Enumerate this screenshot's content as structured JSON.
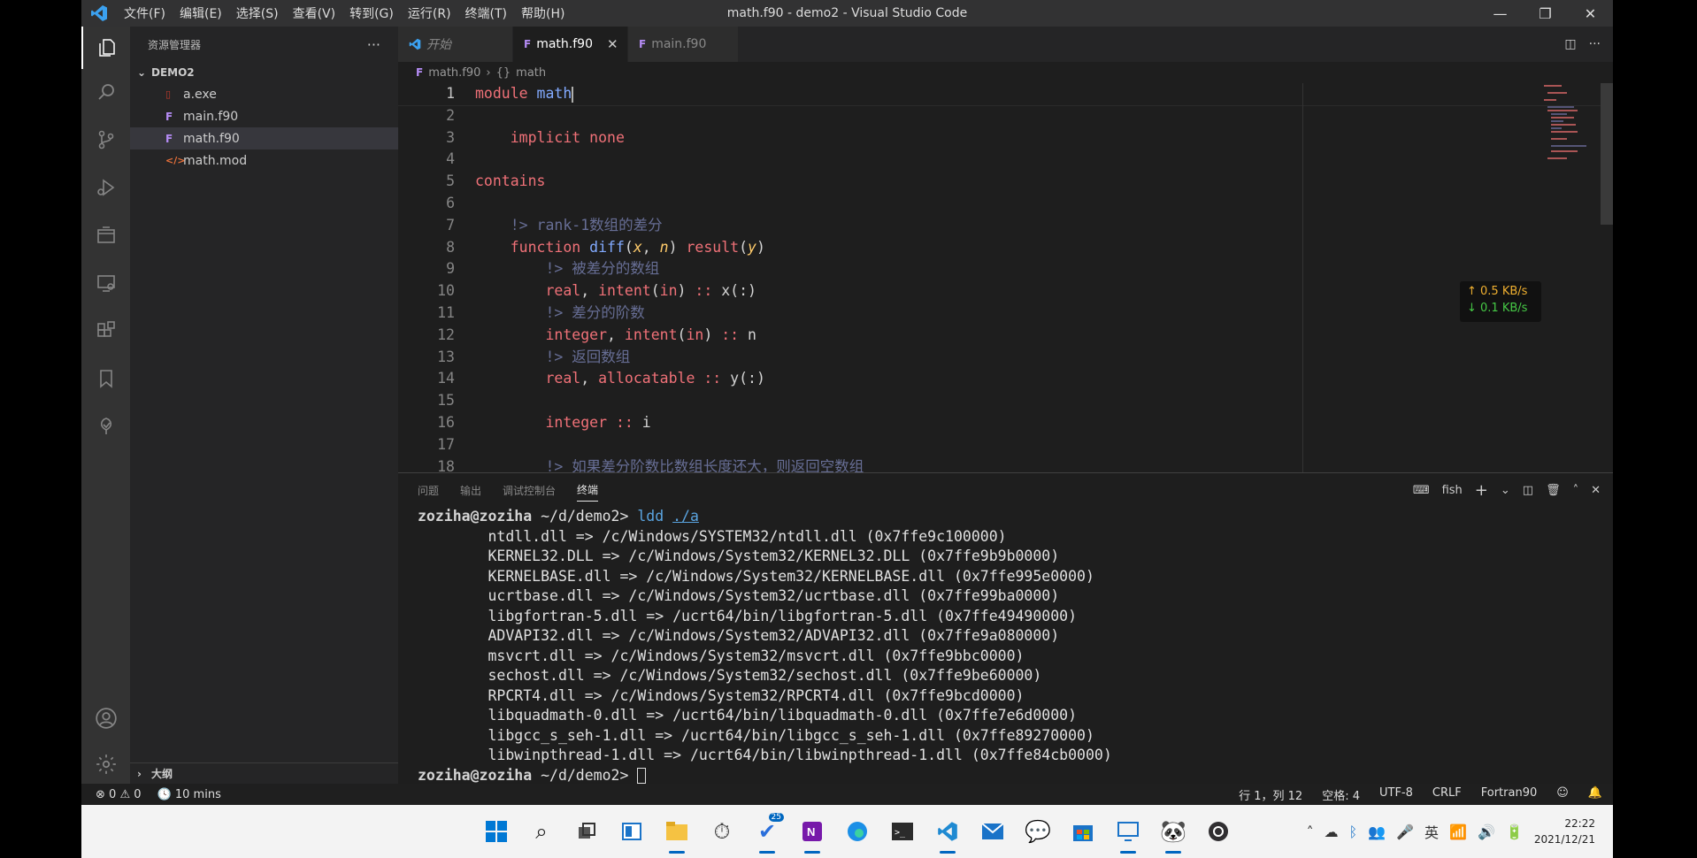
{
  "window": {
    "title": "math.f90 - demo2 - Visual Studio Code",
    "menu": [
      "文件(F)",
      "编辑(E)",
      "选择(S)",
      "查看(V)",
      "转到(G)",
      "运行(R)",
      "终端(T)",
      "帮助(H)"
    ]
  },
  "sidebar": {
    "title": "资源管理器",
    "folder": "DEMO2",
    "files": [
      {
        "name": "a.exe",
        "icon": "exe-file-icon",
        "selected": false
      },
      {
        "name": "main.f90",
        "icon": "fortran-file-icon",
        "selected": false
      },
      {
        "name": "math.f90",
        "icon": "fortran-file-icon",
        "selected": true
      },
      {
        "name": "math.mod",
        "icon": "code-file-icon",
        "selected": false
      }
    ],
    "outline_label": "大纲"
  },
  "tabs": [
    {
      "label": "开始",
      "active": false
    },
    {
      "label": "math.f90",
      "active": true
    },
    {
      "label": "main.f90",
      "active": false
    }
  ],
  "breadcrumb": {
    "file": "math.f90",
    "symbol": "math"
  },
  "code": {
    "current_line": 1,
    "lines": [
      {
        "n": "1",
        "tokens": [
          [
            "k",
            "module"
          ],
          [
            "p",
            " "
          ],
          [
            "n",
            "math"
          ]
        ]
      },
      {
        "n": "2",
        "tokens": []
      },
      {
        "n": "3",
        "tokens": [
          [
            "p",
            "    "
          ],
          [
            "k",
            "implicit none"
          ]
        ]
      },
      {
        "n": "4",
        "tokens": []
      },
      {
        "n": "5",
        "tokens": [
          [
            "k",
            "contains"
          ]
        ]
      },
      {
        "n": "6",
        "tokens": []
      },
      {
        "n": "7",
        "tokens": [
          [
            "p",
            "    "
          ],
          [
            "c",
            "!> rank-1数组的差分"
          ]
        ]
      },
      {
        "n": "8",
        "tokens": [
          [
            "p",
            "    "
          ],
          [
            "k",
            "function"
          ],
          [
            "p",
            " "
          ],
          [
            "n",
            "diff"
          ],
          [
            "p",
            "("
          ],
          [
            "v",
            "x"
          ],
          [
            "p",
            ", "
          ],
          [
            "v",
            "n"
          ],
          [
            "p",
            ") "
          ],
          [
            "k",
            "result"
          ],
          [
            "p",
            "("
          ],
          [
            "v",
            "y"
          ],
          [
            "p",
            ")"
          ]
        ]
      },
      {
        "n": "9",
        "tokens": [
          [
            "p",
            "        "
          ],
          [
            "c",
            "!> 被差分的数组"
          ]
        ]
      },
      {
        "n": "10",
        "tokens": [
          [
            "p",
            "        "
          ],
          [
            "k",
            "real"
          ],
          [
            "p",
            ", "
          ],
          [
            "k",
            "intent"
          ],
          [
            "p",
            "("
          ],
          [
            "k",
            "in"
          ],
          [
            "p",
            ") "
          ],
          [
            "k",
            "::"
          ],
          [
            "p",
            " x(:)"
          ]
        ]
      },
      {
        "n": "11",
        "tokens": [
          [
            "p",
            "        "
          ],
          [
            "c",
            "!> 差分的阶数"
          ]
        ]
      },
      {
        "n": "12",
        "tokens": [
          [
            "p",
            "        "
          ],
          [
            "k",
            "integer"
          ],
          [
            "p",
            ", "
          ],
          [
            "k",
            "intent"
          ],
          [
            "p",
            "("
          ],
          [
            "k",
            "in"
          ],
          [
            "p",
            ") "
          ],
          [
            "k",
            "::"
          ],
          [
            "p",
            " n"
          ]
        ]
      },
      {
        "n": "13",
        "tokens": [
          [
            "p",
            "        "
          ],
          [
            "c",
            "!> 返回数组"
          ]
        ]
      },
      {
        "n": "14",
        "tokens": [
          [
            "p",
            "        "
          ],
          [
            "k",
            "real"
          ],
          [
            "p",
            ", "
          ],
          [
            "k",
            "allocatable"
          ],
          [
            "p",
            " "
          ],
          [
            "k",
            "::"
          ],
          [
            "p",
            " y(:)"
          ]
        ]
      },
      {
        "n": "15",
        "tokens": []
      },
      {
        "n": "16",
        "tokens": [
          [
            "p",
            "        "
          ],
          [
            "k",
            "integer"
          ],
          [
            "p",
            " "
          ],
          [
            "k",
            "::"
          ],
          [
            "p",
            " i"
          ]
        ]
      },
      {
        "n": "17",
        "tokens": []
      },
      {
        "n": "18",
        "tokens": [
          [
            "p",
            "        "
          ],
          [
            "c",
            "!> 如果差分阶数比数组长度还大，则返回空数组"
          ]
        ]
      }
    ]
  },
  "netmon": {
    "up": "↑ 0.5 KB/s",
    "down": "↓ 0.1 KB/s"
  },
  "panel": {
    "tabs": [
      "问题",
      "输出",
      "调试控制台",
      "终端"
    ],
    "active_tab": "终端",
    "shell": "fish",
    "prompt_user": "zoziha@zoziha",
    "prompt_path": " ~/d/demo2> ",
    "command": "ldd",
    "command_arg": "./a",
    "output": [
      "        ntdll.dll => /c/Windows/SYSTEM32/ntdll.dll (0x7ffe9c100000)",
      "        KERNEL32.DLL => /c/Windows/System32/KERNEL32.DLL (0x7ffe9b9b0000)",
      "        KERNELBASE.dll => /c/Windows/System32/KERNELBASE.dll (0x7ffe995e0000)",
      "        ucrtbase.dll => /c/Windows/System32/ucrtbase.dll (0x7ffe99ba0000)",
      "        libgfortran-5.dll => /ucrt64/bin/libgfortran-5.dll (0x7ffe49490000)",
      "        ADVAPI32.dll => /c/Windows/System32/ADVAPI32.dll (0x7ffe9a080000)",
      "        msvcrt.dll => /c/Windows/System32/msvcrt.dll (0x7ffe9bbc0000)",
      "        sechost.dll => /c/Windows/System32/sechost.dll (0x7ffe9be60000)",
      "        RPCRT4.dll => /c/Windows/System32/RPCRT4.dll (0x7ffe9bcd0000)",
      "        libquadmath-0.dll => /ucrt64/bin/libquadmath-0.dll (0x7ffe7e6d0000)",
      "        libgcc_s_seh-1.dll => /ucrt64/bin/libgcc_s_seh-1.dll (0x7ffe89270000)",
      "        libwinpthread-1.dll => /ucrt64/bin/libwinpthread-1.dll (0x7ffe84cb0000)"
    ]
  },
  "status": {
    "errors": "0",
    "warnings": "0",
    "timer": "10 mins",
    "cursor": "行 1，列 12",
    "spaces": "空格: 4",
    "encoding": "UTF-8",
    "eol": "CRLF",
    "language": "Fortran90"
  },
  "taskbar": {
    "badge": "25",
    "ime": "英",
    "time": "22:22",
    "date": "2021/12/21"
  },
  "colors": {
    "accent": "#0067c0",
    "keyword": "#f07178",
    "name": "#82aaff",
    "arg": "#ffcb6b",
    "comment": "#676e95"
  }
}
